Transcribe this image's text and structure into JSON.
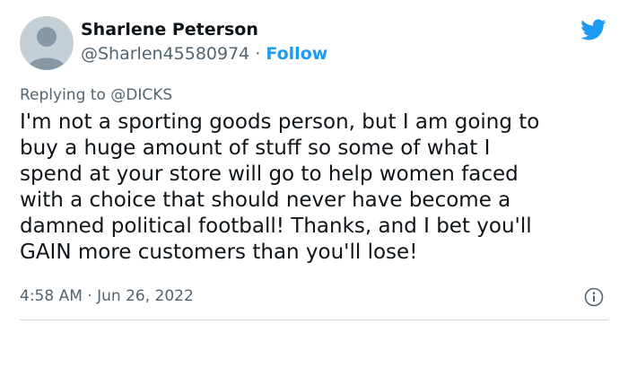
{
  "user": {
    "display_name": "Sharlene Peterson",
    "handle": "@Sharlen45580974",
    "separator": " · ",
    "follow_label": "Follow"
  },
  "reply": {
    "prefix": "Replying to ",
    "mention": "@DICKS"
  },
  "tweet": {
    "lines": [
      "I'm not a sporting goods person, but I am going to",
      "buy a huge amount of stuff so some of what I",
      "spend at your store will go to help women faced",
      "with a choice that should never have become a",
      "damned political football! Thanks, and I bet you'll",
      "GAIN more customers than you'll lose!"
    ]
  },
  "meta": {
    "time": "4:58 AM",
    "separator": " · ",
    "date": "Jun 26, 2022"
  },
  "icons": {
    "brand": "twitter-bird-icon",
    "info": "info-icon",
    "avatar": "default-avatar-icon"
  },
  "colors": {
    "accent": "#1d9bf0",
    "text": "#0f1419",
    "secondary": "#536471",
    "divider": "#cfd9de",
    "avatar_bg": "#c4cfd6"
  }
}
